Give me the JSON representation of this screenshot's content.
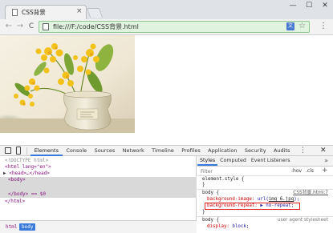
{
  "browser": {
    "tab_title": "CSS背景",
    "tab_close": "×",
    "window_controls": [
      "—",
      "☐",
      "✕"
    ],
    "address": "file:///F:/code/CSS背景.html",
    "nav": {
      "back": "←",
      "forward": "→",
      "reload": "C"
    },
    "menu": "⋮",
    "translate_glyph": "文"
  },
  "devtools": {
    "tabs": [
      "Elements",
      "Console",
      "Sources",
      "Network",
      "Timeline",
      "Profiles",
      "Application",
      "Security",
      "Audits"
    ],
    "active_tab": "Elements",
    "more": "»",
    "close": "✕",
    "dom_lines": [
      "<!DOCTYPE html>",
      "<html lang=\"en\">",
      "<head>…</head>",
      "<body>",
      "</body> == $0",
      "</html>"
    ],
    "breadcrumb": [
      "html",
      "body"
    ],
    "styles_tabs": [
      "Styles",
      "Computed",
      "Event Listeners"
    ],
    "filter_placeholder": "Filter",
    "hov": ":hov",
    "cls": ".cls",
    "add": "+",
    "rules": {
      "element_style_selector": "element.style {",
      "element_style_close": "}",
      "body_selector": "body {",
      "body_source": "CSS背景.html:7",
      "bg_image_prop": "background-image:",
      "bg_image_val_pre": "url(",
      "bg_image_link": "img_6.jpg",
      "bg_image_val_post": ");",
      "bg_repeat_prop": "background-repeat:",
      "bg_repeat_val": "▶ no-repeat;",
      "body_close": "}",
      "ua_selector": "body {",
      "ua_source": "user agent stylesheet",
      "ua_display_prop": "display:",
      "ua_display_val": "block;"
    }
  },
  "colors": {
    "omnibox_bg": "#dff3df",
    "devtools_accent": "#3879d9",
    "highlight_box": "#e02020",
    "tag_color": "#881280"
  }
}
